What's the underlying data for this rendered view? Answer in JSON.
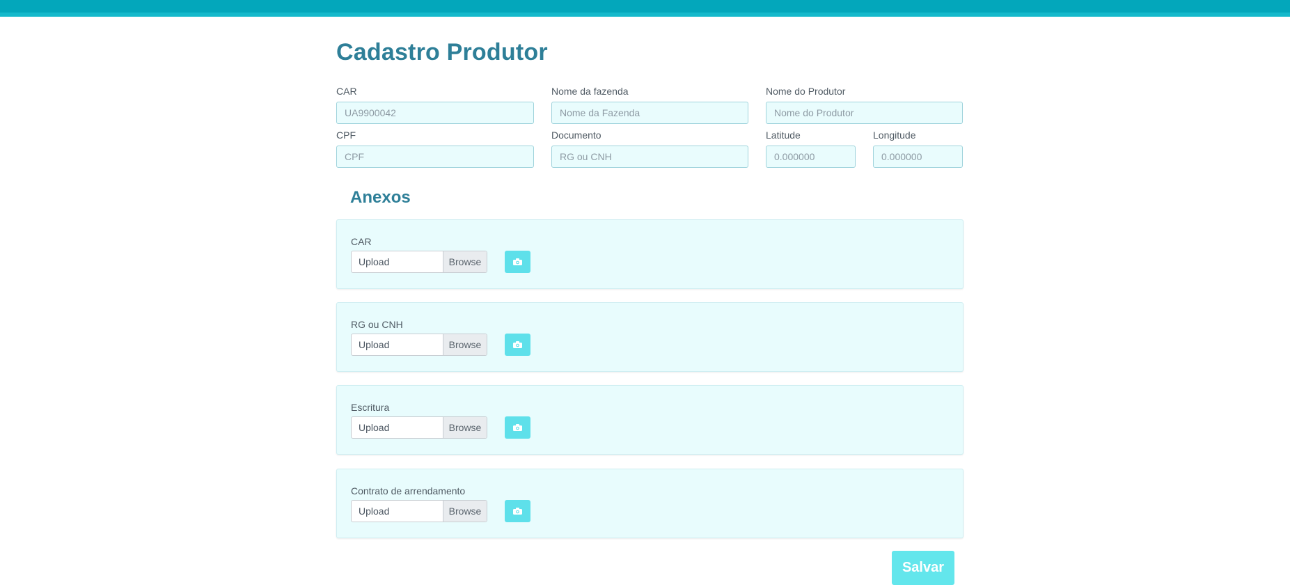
{
  "page": {
    "title": "Cadastro Produtor"
  },
  "form": {
    "car": {
      "label": "CAR",
      "placeholder": "UA9900042"
    },
    "fazenda": {
      "label": "Nome da fazenda",
      "placeholder": "Nome da Fazenda"
    },
    "produtor": {
      "label": "Nome do Produtor",
      "placeholder": "Nome do Produtor"
    },
    "cpf": {
      "label": "CPF",
      "placeholder": "CPF"
    },
    "documento": {
      "label": "Documento",
      "placeholder": "RG ou CNH"
    },
    "latitude": {
      "label": "Latitude",
      "placeholder": "0.000000"
    },
    "longitude": {
      "label": "Longitude",
      "placeholder": "0.000000"
    }
  },
  "anexos": {
    "title": "Anexos",
    "items": [
      {
        "label": "CAR",
        "upload": "Upload",
        "browse": "Browse",
        "icon": "camera-icon"
      },
      {
        "label": "RG ou CNH",
        "upload": "Upload",
        "browse": "Browse",
        "icon": "camera-icon"
      },
      {
        "label": "Escritura",
        "upload": "Upload",
        "browse": "Browse",
        "icon": "camera-icon"
      },
      {
        "label": "Contrato de arrendamento",
        "upload": "Upload",
        "browse": "Browse",
        "icon": "camera-icon"
      }
    ]
  },
  "actions": {
    "save_label": "Salvar"
  },
  "colors": {
    "topbar": "#03a7bb",
    "title": "#2e7f98",
    "input_bg": "#e9fcfd",
    "card_bg": "#e8fcfd",
    "accent": "#5ee0ea"
  }
}
